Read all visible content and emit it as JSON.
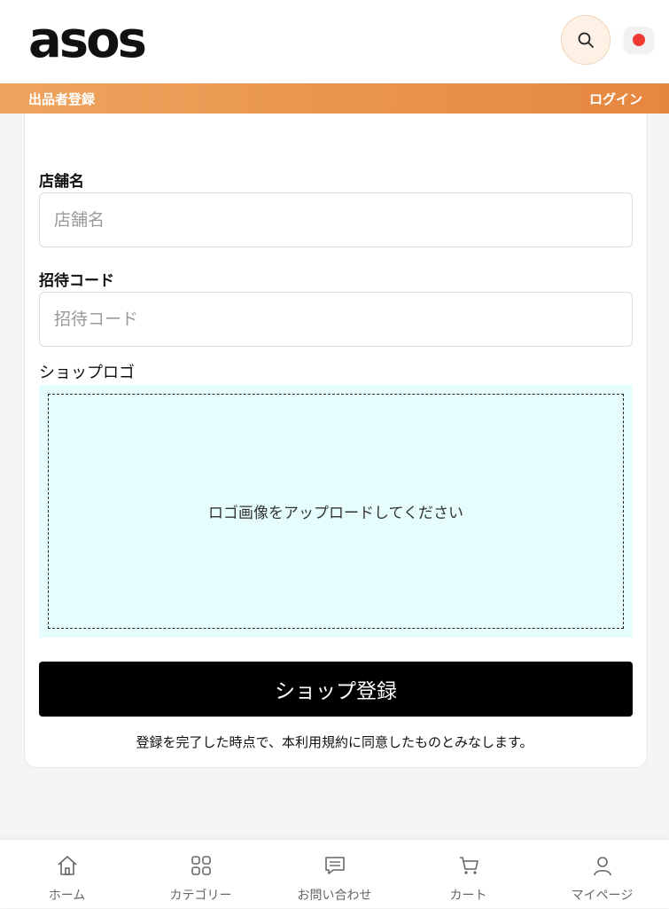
{
  "header": {
    "logo_text": "asos",
    "search_icon": "search-icon",
    "flag_icon": "japan-flag-icon"
  },
  "subbar": {
    "left": "出品者登録",
    "right": "ログイン"
  },
  "form": {
    "shop_name": {
      "label": "店舗名",
      "placeholder": "店舗名",
      "value": ""
    },
    "invite_code": {
      "label": "招待コード",
      "placeholder": "招待コード",
      "value": ""
    },
    "shop_logo": {
      "label": "ショップロゴ",
      "upload_text": "ロゴ画像をアップロードしてください"
    },
    "submit_label": "ショップ登録",
    "terms_text": "登録を完了した時点で、本利用規約に同意したものとみなします。"
  },
  "bottom_nav": {
    "items": [
      {
        "label": "ホーム",
        "icon": "home-icon"
      },
      {
        "label": "カテゴリー",
        "icon": "grid-icon"
      },
      {
        "label": "お問い合わせ",
        "icon": "message-icon"
      },
      {
        "label": "カート",
        "icon": "cart-icon"
      },
      {
        "label": "マイページ",
        "icon": "user-icon"
      }
    ]
  },
  "colors": {
    "accent_orange": "#e5873f",
    "upload_bg": "#e6fdfe",
    "button_bg": "#000000"
  }
}
